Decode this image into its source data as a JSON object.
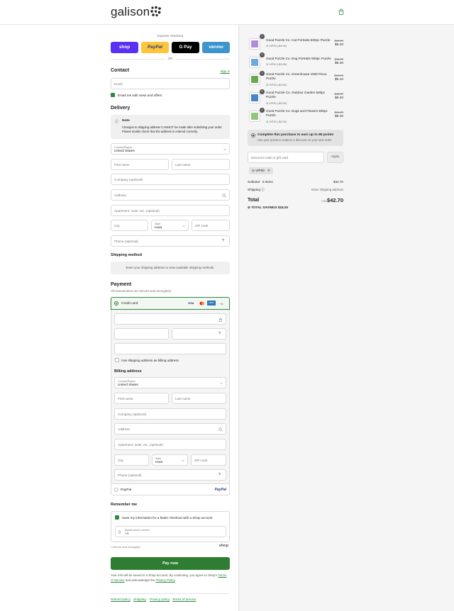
{
  "header": {
    "brand": "galison"
  },
  "express": {
    "label": "Express checkout",
    "buttons": [
      {
        "name": "shop",
        "label": "shop",
        "color": "#5a31f4"
      },
      {
        "name": "paypal",
        "label": "PayPal",
        "color": "#ffc439"
      },
      {
        "name": "gpay",
        "label": "G Pay",
        "color": "#000000"
      },
      {
        "name": "venmo",
        "label": "venmo",
        "color": "#3d95ce"
      }
    ],
    "or": "OR"
  },
  "contact": {
    "title": "Contact",
    "sign_in": "Sign in",
    "email_placeholder": "Email",
    "newsletter_label": "Email me with news and offers"
  },
  "delivery": {
    "title": "Delivery",
    "note_title": "Note",
    "note_text": "Changes to shipping address CANNOT be made after submitting your order. Please double check that the address is entered correctly.",
    "country_label": "Country/Region",
    "country_value": "United States",
    "first_name": "First name",
    "last_name": "Last name",
    "company": "Company (optional)",
    "address": "Address",
    "apartment": "Apartment, suite, etc. (optional)",
    "city": "City",
    "state_label": "State",
    "state_value": "Iowa",
    "zip": "ZIP code",
    "phone": "Phone (optional)"
  },
  "shipping_method": {
    "title": "Shipping method",
    "text": "Enter your shipping address to view available shipping methods."
  },
  "payment": {
    "title": "Payment",
    "subtitle": "All transactions are secure and encrypted.",
    "credit_card": "Credit card",
    "more_cards": "+4",
    "card_brands": [
      "VISA",
      "MC",
      "AMEX"
    ],
    "use_shipping": "Use shipping address as billing address",
    "billing_title": "Billing address",
    "paypal_label": "PayPal",
    "paypal_logo": "PayPal"
  },
  "remember": {
    "title": "Remember me",
    "save_label": "Save my information for a faster checkout with a Shop account",
    "mobile_label": "Mobile phone number",
    "mobile_value": "+1",
    "secure": "Secure and encrypted",
    "shop": "shop"
  },
  "pay_now": "Pay now",
  "legal": {
    "text": "Your info will be saved to a Shop account. By continuing, you agree to Shop's",
    "terms": "Terms of Service",
    "and": "and acknowledge the",
    "privacy": "Privacy Policy",
    "end": "."
  },
  "footer": [
    "Refund policy",
    "Shipping",
    "Privacy policy",
    "Terms of service"
  ],
  "order": {
    "items": [
      {
        "name": "Good Puzzle Co. Cat Portraits 500pc Puzzle",
        "qty": "1",
        "discount": "VIP30 (-$3.59)",
        "old": "$11.99",
        "price": "$8.40",
        "color": "#b58ad6"
      },
      {
        "name": "Good Puzzle Co. Dog Portraits 500pc Puzzle",
        "qty": "1",
        "discount": "VIP30 (-$3.59)",
        "old": "$11.99",
        "price": "$8.40",
        "color": "#6fa8dc"
      },
      {
        "name": "Good Puzzle Co. Greenhouse 1000 Piece Puzzle",
        "qty": "1",
        "discount": "VIP30 (-$3.89)",
        "old": "$12.99",
        "price": "$9.10",
        "color": "#6aa84f"
      },
      {
        "name": "Good Puzzle Co. Outdoor Garden 500pc Puzzle",
        "qty": "1",
        "discount": "VIP30 (-$3.59)",
        "old": "$11.99",
        "price": "$8.40",
        "color": "#4a86c5"
      },
      {
        "name": "Good Puzzle Co. Dogs and Flowers 500pc Puzzle",
        "qty": "1",
        "discount": "VIP30 (-$3.59)",
        "old": "$11.99",
        "price": "$8.40",
        "color": "#93c47d"
      }
    ],
    "points_title": "Complete this purchase to earn up to 85 points",
    "points_sub": "Use your points to redeem a discount on your next order.",
    "discount_placeholder": "Discount code or gift card",
    "apply": "Apply",
    "code_tag": "VIP30",
    "subtotal_label": "Subtotal · 5 items",
    "subtotal_value": "$42.70",
    "shipping_label": "Shipping",
    "shipping_value": "Enter shipping address",
    "total_label": "Total",
    "currency": "USD",
    "total_value": "$42.70",
    "savings_label": "TOTAL SAVINGS",
    "savings_value": "$18.25"
  },
  "colors": {
    "accent": "#2b8a3e",
    "pay": "#2e7d32"
  }
}
